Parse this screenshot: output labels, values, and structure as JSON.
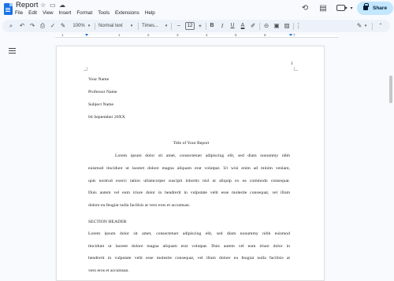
{
  "window": {
    "title": "Report"
  },
  "menu": [
    "File",
    "Edit",
    "View",
    "Insert",
    "Format",
    "Tools",
    "Extensions",
    "Help"
  ],
  "header": {
    "share_label": "Share"
  },
  "toolbar": {
    "zoom": "100%",
    "style": "Normal text",
    "font": "Times...",
    "font_size": "12"
  },
  "ruler": {
    "numbers": [
      "1",
      "1",
      "2",
      "3",
      "4",
      "5",
      "6",
      "7"
    ]
  },
  "document": {
    "page_number": "1",
    "heading_lines": [
      "Your Name",
      "Professor Name",
      "Subject Name",
      "04 September 20XX"
    ],
    "title": "Title of Your Report",
    "paragraph1": [
      "Lorem ipsum dolor sit amet, consectetuer adipiscing elit, sed diam nonummy nibh",
      "euismod tincidunt ut laoreet dolore magna aliquam erat volutpat. Ut wisi enim ad minim veniam,",
      "quis nostrud exerci tation ullamcorper suscipit lobortis nisl ut aliquip ex ea commodo consequat.",
      "Duis autem vel eum iriure dolor in hendrerit in vulputate velit esse molestie consequat, vel illum",
      "dolore eu feugiat nulla facilisis at vero eros et accumsan."
    ],
    "section_header": "SECTION HEADER",
    "paragraph2": [
      "Lorem ipsum dolor sit amet, consectetuer adipiscing elit, sed diam nonummy nibh euismod",
      "tincidunt ut laoreet dolore magna aliquam erat volutpat. Duis autem vel eum iriure dolor in",
      "hendrerit in vulputate velit esse molestie consequat, vel illum dolore eu feugiat nulla facilisis at",
      "vero eros et accumsan."
    ]
  }
}
